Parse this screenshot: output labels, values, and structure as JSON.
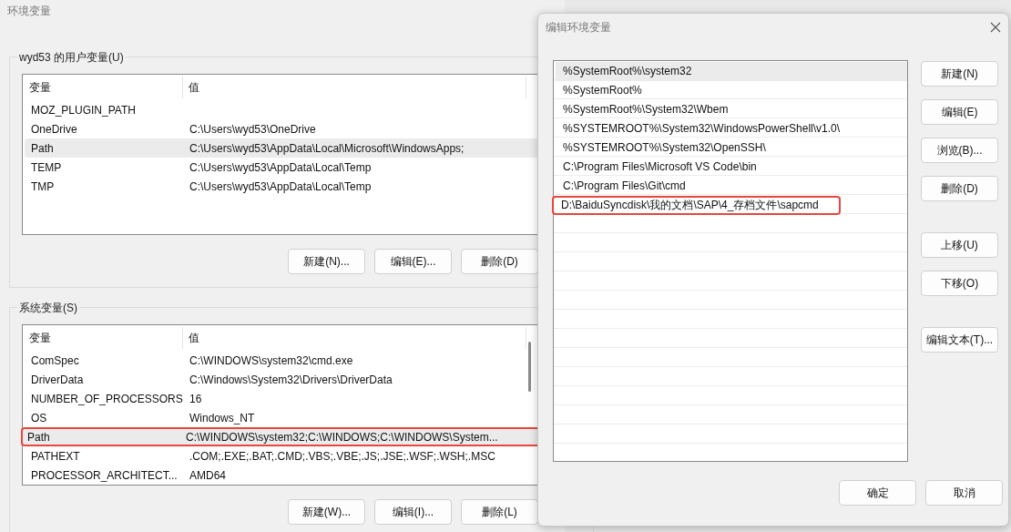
{
  "main_window": {
    "title": "环境变量",
    "user_vars": {
      "title": "wyd53 的用户变量(U)",
      "columns": [
        "变量",
        "值"
      ],
      "rows": [
        {
          "name": "MOZ_PLUGIN_PATH",
          "value": "",
          "selected": false,
          "highlighted": false
        },
        {
          "name": "OneDrive",
          "value": "C:\\Users\\wyd53\\OneDrive",
          "selected": false,
          "highlighted": false
        },
        {
          "name": "Path",
          "value": "C:\\Users\\wyd53\\AppData\\Local\\Microsoft\\WindowsApps;",
          "selected": true,
          "highlighted": false
        },
        {
          "name": "TEMP",
          "value": "C:\\Users\\wyd53\\AppData\\Local\\Temp",
          "selected": false,
          "highlighted": false
        },
        {
          "name": "TMP",
          "value": "C:\\Users\\wyd53\\AppData\\Local\\Temp",
          "selected": false,
          "highlighted": false
        }
      ],
      "buttons": [
        "新建(N)...",
        "编辑(E)...",
        "删除(D)"
      ]
    },
    "system_vars": {
      "title": "系统变量(S)",
      "columns": [
        "变量",
        "值"
      ],
      "rows": [
        {
          "name": "ComSpec",
          "value": "C:\\WINDOWS\\system32\\cmd.exe",
          "selected": false,
          "highlighted": false
        },
        {
          "name": "DriverData",
          "value": "C:\\Windows\\System32\\Drivers\\DriverData",
          "selected": false,
          "highlighted": false
        },
        {
          "name": "NUMBER_OF_PROCESSORS",
          "value": "16",
          "selected": false,
          "highlighted": false
        },
        {
          "name": "OS",
          "value": "Windows_NT",
          "selected": false,
          "highlighted": false
        },
        {
          "name": "Path",
          "value": "C:\\WINDOWS\\system32;C:\\WINDOWS;C:\\WINDOWS\\System...",
          "selected": true,
          "highlighted": true
        },
        {
          "name": "PATHEXT",
          "value": ".COM;.EXE;.BAT;.CMD;.VBS;.VBE;.JS;.JSE;.WSF;.WSH;.MSC",
          "selected": false,
          "highlighted": false
        },
        {
          "name": "PROCESSOR_ARCHITECT...",
          "value": "AMD64",
          "selected": false,
          "highlighted": false
        }
      ],
      "buttons": [
        "新建(W)...",
        "编辑(I)...",
        "删除(L)"
      ]
    }
  },
  "edit_dialog": {
    "title": "编辑环境变量",
    "entries": [
      {
        "text": "%SystemRoot%\\system32",
        "selected": true,
        "highlighted": false
      },
      {
        "text": "%SystemRoot%",
        "selected": false,
        "highlighted": false
      },
      {
        "text": "%SystemRoot%\\System32\\Wbem",
        "selected": false,
        "highlighted": false
      },
      {
        "text": "%SYSTEMROOT%\\System32\\WindowsPowerShell\\v1.0\\",
        "selected": false,
        "highlighted": false
      },
      {
        "text": "%SYSTEMROOT%\\System32\\OpenSSH\\",
        "selected": false,
        "highlighted": false
      },
      {
        "text": "C:\\Program Files\\Microsoft VS Code\\bin",
        "selected": false,
        "highlighted": false
      },
      {
        "text": "C:\\Program Files\\Git\\cmd",
        "selected": false,
        "highlighted": false
      },
      {
        "text": "D:\\BaiduSyncdisk\\我的文档\\SAP\\4_存档文件\\sapcmd",
        "selected": false,
        "highlighted": true
      }
    ],
    "side_button_groups": [
      [
        "新建(N)",
        "编辑(E)",
        "浏览(B)...",
        "删除(D)"
      ],
      [
        "上移(U)",
        "下移(O)"
      ],
      [
        "编辑文本(T)..."
      ]
    ],
    "footer_buttons": [
      "确定",
      "取消"
    ]
  }
}
